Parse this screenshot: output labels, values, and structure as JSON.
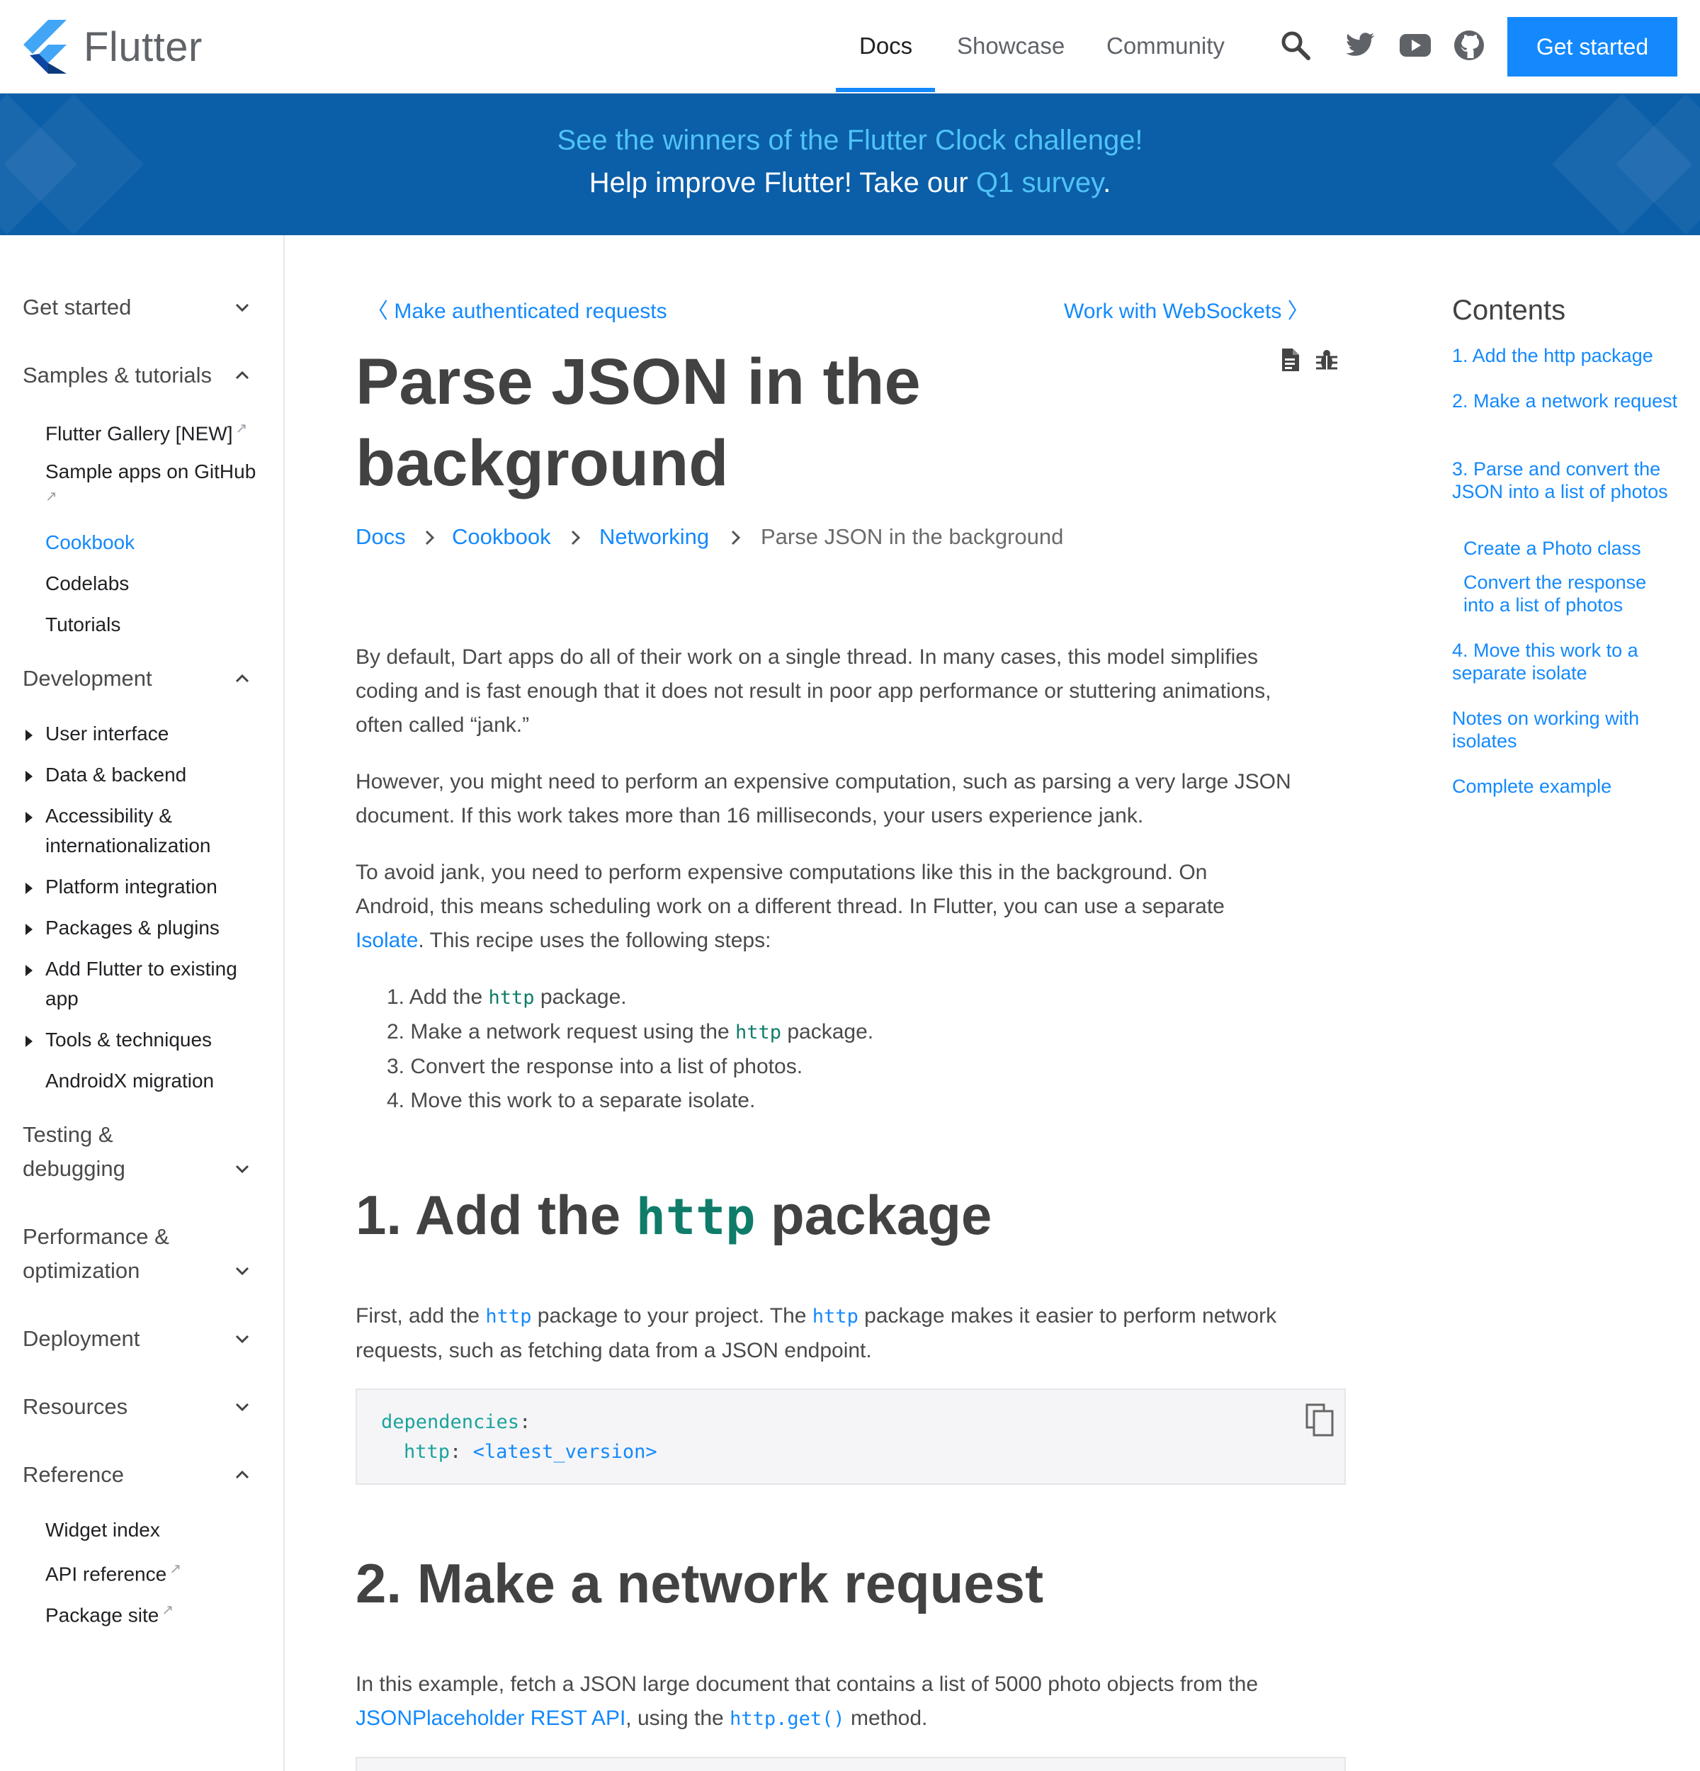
{
  "header": {
    "brand": "Flutter",
    "nav": [
      {
        "label": "Docs",
        "active": true
      },
      {
        "label": "Showcase",
        "active": false
      },
      {
        "label": "Community",
        "active": false
      }
    ],
    "icons": [
      "search-icon",
      "twitter-icon",
      "youtube-icon",
      "github-icon"
    ],
    "cta": "Get started"
  },
  "banner": {
    "line1": "See the winners of the Flutter Clock challenge!",
    "line2_prefix": "Help improve Flutter! Take our ",
    "line2_link": "Q1 survey",
    "line2_suffix": "."
  },
  "sidebar": {
    "sections": [
      {
        "label": "Get started",
        "expanded": false
      },
      {
        "label": "Samples & tutorials",
        "expanded": true,
        "items": [
          "Flutter Gallery [NEW]",
          "Sample apps on GitHub",
          "Cookbook",
          "Codelabs",
          "Tutorials"
        ]
      },
      {
        "label": "Development",
        "expanded": true,
        "items": [
          "User interface",
          "Data & backend",
          "Accessibility &",
          "internationalization",
          "Platform integration",
          "Packages & plugins",
          "Add Flutter to existing",
          "app",
          "Tools & techniques",
          "AndroidX migration"
        ]
      },
      {
        "label": "Testing &",
        "label2": "debugging",
        "expanded": false
      },
      {
        "label": "Performance &",
        "label2": "optimization",
        "expanded": false
      },
      {
        "label": "Deployment",
        "expanded": false
      },
      {
        "label": "Resources",
        "expanded": false
      },
      {
        "label": "Reference",
        "expanded": true,
        "items": [
          "Widget index",
          "API reference",
          "Package site"
        ]
      }
    ],
    "active_item": "Cookbook"
  },
  "main": {
    "prev": "Make authenticated requests",
    "next": "Work with WebSockets",
    "title_line1": "Parse JSON in the",
    "title_line2": "background",
    "breadcrumb": [
      "Docs",
      "Cookbook",
      "Networking",
      "Parse JSON in the background"
    ],
    "p1": [
      "By default, Dart apps do all of their work on a single thread. In many cases, this model simplifies",
      "coding and is fast enough that it does not result in poor app performance or stuttering animations,",
      "often called “jank.”"
    ],
    "p2": [
      "However, you might need to perform an expensive computation, such as parsing a very large JSON",
      "document. If this work takes more than 16 milliseconds, your users experience jank."
    ],
    "p3": [
      "To avoid jank, you need to perform expensive computations like this in the background. On",
      "Android, this means scheduling work on a different thread. In Flutter, you can use a separate"
    ],
    "p3_link": "Isolate",
    "p3_tail": ". This recipe uses the following steps:",
    "steps": [
      {
        "num": "1.",
        "pre": "Add the ",
        "code": "http",
        "post": " package."
      },
      {
        "num": "2.",
        "pre": "Make a network request using the ",
        "code": "http",
        "post": " package."
      },
      {
        "num": "3.",
        "pre": "Convert the response into a list of photos.",
        "code": "",
        "post": ""
      },
      {
        "num": "4.",
        "pre": "Move this work to a separate isolate.",
        "code": "",
        "post": ""
      }
    ],
    "h2_1_pre": "1. Add the ",
    "h2_1_code": "http",
    "h2_1_post": " package",
    "p4_a": "First, add the ",
    "p4_code1": "http",
    "p4_b": " package to your project. The ",
    "p4_code2": "http",
    "p4_c": " package makes it easier to perform network",
    "p4_line2": "requests, such as fetching data from a JSON endpoint.",
    "code1_line1_key": "dependencies",
    "code1_line1_punct": ":",
    "code1_line2_key": "http",
    "code1_line2_punct": ":",
    "code1_line2_val": "<latest_version>",
    "h2_2": "2. Make a network request",
    "p5_line1": "In this example, fetch a JSON large document that contains a list of 5000 photo objects from the",
    "p5_link": "JSONPlaceholder REST API",
    "p5_mid": ", using the ",
    "p5_code": "http.get()",
    "p5_tail": " method."
  },
  "toc": {
    "title": "Contents",
    "items": [
      {
        "label": "1. Add the http package",
        "sub": false
      },
      {
        "label": "2. Make a network request",
        "sub": false
      },
      {
        "label": "3. Parse and convert the JSON into a list of photos",
        "sub": false
      },
      {
        "label": "Create a Photo class",
        "sub": true
      },
      {
        "label": "Convert the response into a list of photos",
        "sub": true
      },
      {
        "label": "4. Move this work to a separate isolate",
        "sub": false
      },
      {
        "label": "Notes on working with isolates",
        "sub": false
      },
      {
        "label": "Complete example",
        "sub": false
      }
    ]
  },
  "colors": {
    "accent": "#1389fd",
    "banner_bg": "#0b5ea8",
    "banner_link": "#4fc3f7",
    "code_green": "#0f7c6a"
  }
}
